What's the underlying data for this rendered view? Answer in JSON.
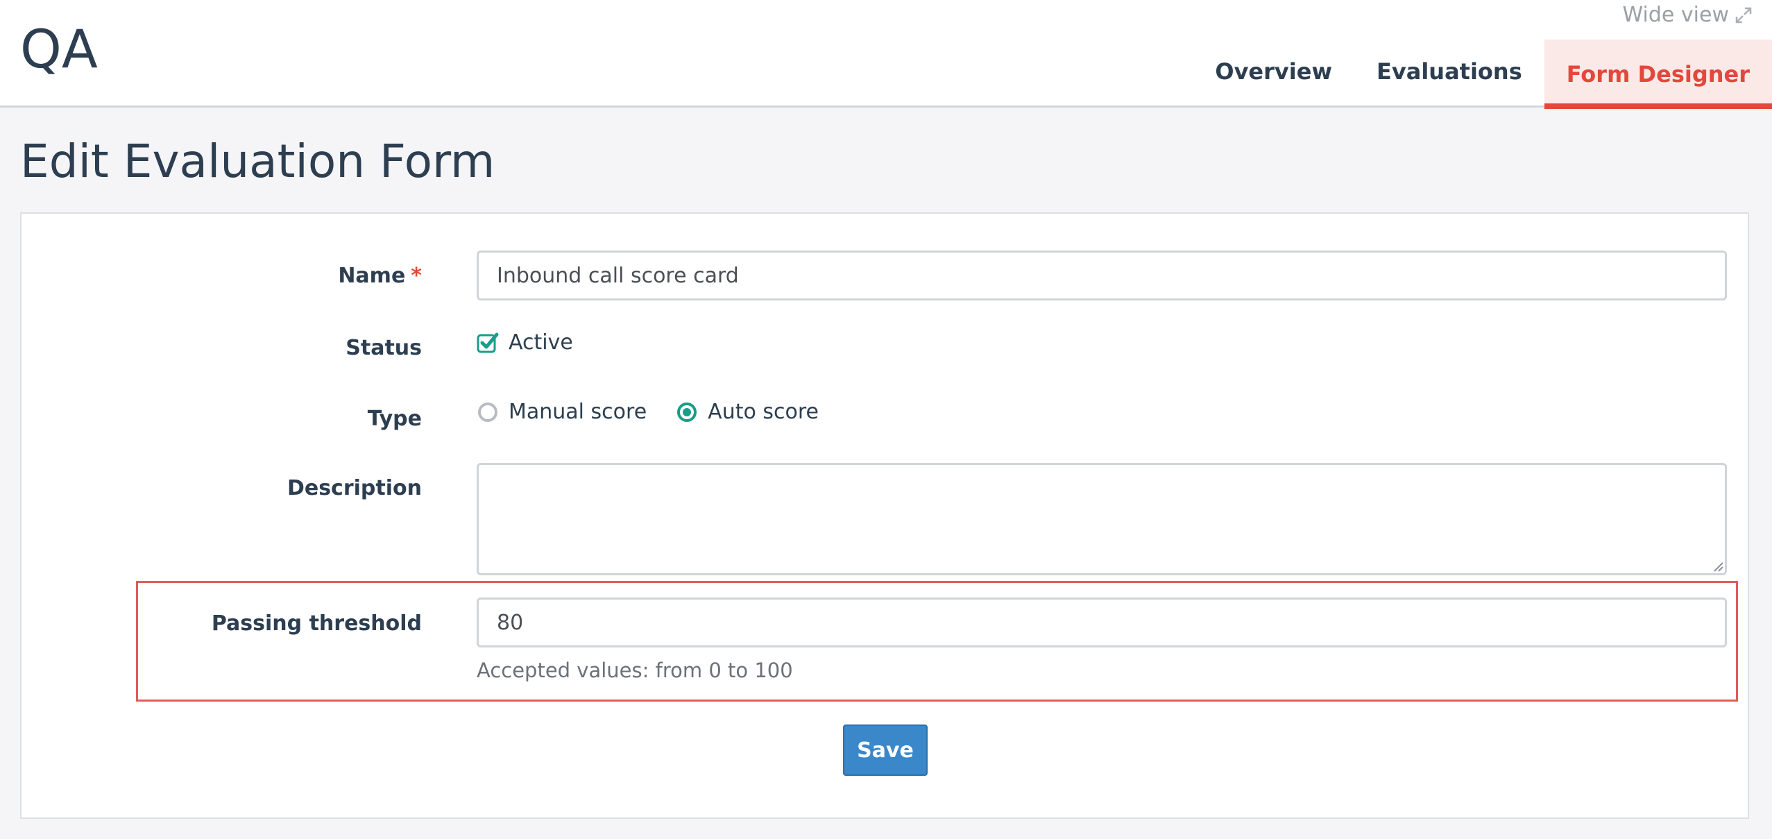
{
  "header": {
    "app_title": "QA",
    "wide_view_label": "Wide view",
    "wide_view_icon": "expand-arrows-icon",
    "tabs": [
      {
        "label": "Overview",
        "active": false
      },
      {
        "label": "Evaluations",
        "active": false
      },
      {
        "label": "Form Designer",
        "active": true
      }
    ]
  },
  "page": {
    "title": "Edit Evaluation Form"
  },
  "form": {
    "name": {
      "label": "Name",
      "required_marker": "*",
      "value": "Inbound call score card"
    },
    "status": {
      "label": "Status",
      "option_label": "Active",
      "checked": true
    },
    "type": {
      "label": "Type",
      "options": [
        {
          "label": "Manual score",
          "selected": false
        },
        {
          "label": "Auto score",
          "selected": true
        }
      ]
    },
    "description": {
      "label": "Description",
      "value": ""
    },
    "passing_threshold": {
      "label": "Passing threshold",
      "value": "80",
      "help": "Accepted values: from 0 to 100"
    },
    "save_label": "Save"
  },
  "colors": {
    "accent_teal": "#1a9c8a",
    "active_tab": "#e2483b",
    "save_button": "#3a87c9",
    "highlight_box": "#e25b5b"
  }
}
